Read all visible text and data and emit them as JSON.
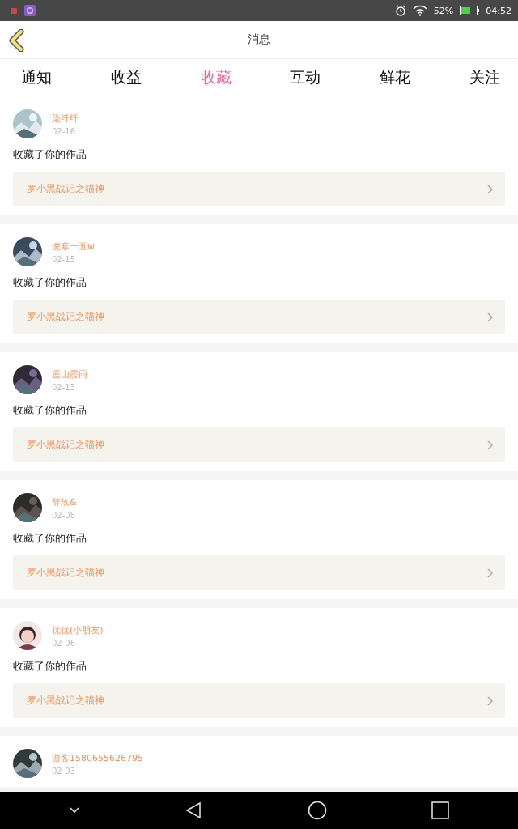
{
  "status_bar": {
    "battery": "52%",
    "time": "04:52"
  },
  "header": {
    "title": "消息"
  },
  "tabs": [
    {
      "label": "通知",
      "selected": false
    },
    {
      "label": "收益",
      "selected": false
    },
    {
      "label": "收藏",
      "selected": true
    },
    {
      "label": "互动",
      "selected": false
    },
    {
      "label": "鲜花",
      "selected": false
    },
    {
      "label": "关注",
      "selected": false
    }
  ],
  "messages": [
    {
      "name": "染纤纤",
      "date": "02-16",
      "action": "收藏了你的作品",
      "work": "罗小黑战记之猫神"
    },
    {
      "name": "凌寒十五w",
      "date": "02-15",
      "action": "收藏了你的作品",
      "work": "罗小黑战记之猫神"
    },
    {
      "name": "遥山霞雨",
      "date": "02-13",
      "action": "收藏了你的作品",
      "work": "罗小黑战记之猫神"
    },
    {
      "name": "辞玖&",
      "date": "02-08",
      "action": "收藏了你的作品",
      "work": "罗小黑战记之猫神"
    },
    {
      "name": "优优(小朋友)",
      "date": "02-06",
      "action": "收藏了你的作品",
      "work": "罗小黑战记之猫神",
      "avatar": {
        "kind": "person"
      }
    },
    {
      "name": "游客1580655626795",
      "date": "02-03"
    }
  ]
}
